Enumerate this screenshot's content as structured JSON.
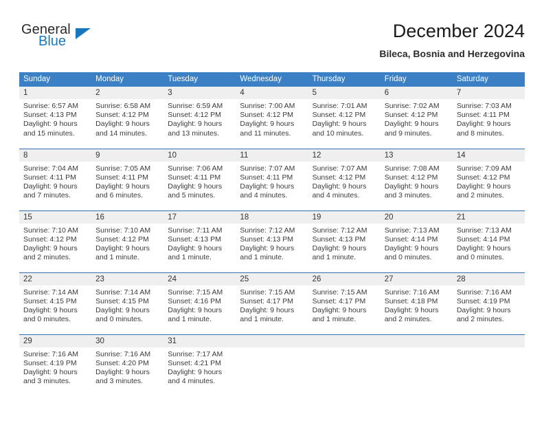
{
  "brand": {
    "word_one": "General",
    "word_two": "Blue",
    "triangle_icon": "triangle-right-icon",
    "accent_color": "#1878be"
  },
  "header": {
    "title": "December 2024",
    "subtitle": "Bileca, Bosnia and Herzegovina"
  },
  "theme": {
    "header_blue": "#3b80c4",
    "rule_blue": "#2f6fb0",
    "daynum_gray": "#efefef"
  },
  "weekday_headers": [
    "Sunday",
    "Monday",
    "Tuesday",
    "Wednesday",
    "Thursday",
    "Friday",
    "Saturday"
  ],
  "weeks": [
    [
      {
        "day": "1",
        "sunrise": "Sunrise: 6:57 AM",
        "sunset": "Sunset: 4:13 PM",
        "daylight_line1": "Daylight: 9 hours",
        "daylight_line2": "and 15 minutes."
      },
      {
        "day": "2",
        "sunrise": "Sunrise: 6:58 AM",
        "sunset": "Sunset: 4:12 PM",
        "daylight_line1": "Daylight: 9 hours",
        "daylight_line2": "and 14 minutes."
      },
      {
        "day": "3",
        "sunrise": "Sunrise: 6:59 AM",
        "sunset": "Sunset: 4:12 PM",
        "daylight_line1": "Daylight: 9 hours",
        "daylight_line2": "and 13 minutes."
      },
      {
        "day": "4",
        "sunrise": "Sunrise: 7:00 AM",
        "sunset": "Sunset: 4:12 PM",
        "daylight_line1": "Daylight: 9 hours",
        "daylight_line2": "and 11 minutes."
      },
      {
        "day": "5",
        "sunrise": "Sunrise: 7:01 AM",
        "sunset": "Sunset: 4:12 PM",
        "daylight_line1": "Daylight: 9 hours",
        "daylight_line2": "and 10 minutes."
      },
      {
        "day": "6",
        "sunrise": "Sunrise: 7:02 AM",
        "sunset": "Sunset: 4:12 PM",
        "daylight_line1": "Daylight: 9 hours",
        "daylight_line2": "and 9 minutes."
      },
      {
        "day": "7",
        "sunrise": "Sunrise: 7:03 AM",
        "sunset": "Sunset: 4:11 PM",
        "daylight_line1": "Daylight: 9 hours",
        "daylight_line2": "and 8 minutes."
      }
    ],
    [
      {
        "day": "8",
        "sunrise": "Sunrise: 7:04 AM",
        "sunset": "Sunset: 4:11 PM",
        "daylight_line1": "Daylight: 9 hours",
        "daylight_line2": "and 7 minutes."
      },
      {
        "day": "9",
        "sunrise": "Sunrise: 7:05 AM",
        "sunset": "Sunset: 4:11 PM",
        "daylight_line1": "Daylight: 9 hours",
        "daylight_line2": "and 6 minutes."
      },
      {
        "day": "10",
        "sunrise": "Sunrise: 7:06 AM",
        "sunset": "Sunset: 4:11 PM",
        "daylight_line1": "Daylight: 9 hours",
        "daylight_line2": "and 5 minutes."
      },
      {
        "day": "11",
        "sunrise": "Sunrise: 7:07 AM",
        "sunset": "Sunset: 4:11 PM",
        "daylight_line1": "Daylight: 9 hours",
        "daylight_line2": "and 4 minutes."
      },
      {
        "day": "12",
        "sunrise": "Sunrise: 7:07 AM",
        "sunset": "Sunset: 4:12 PM",
        "daylight_line1": "Daylight: 9 hours",
        "daylight_line2": "and 4 minutes."
      },
      {
        "day": "13",
        "sunrise": "Sunrise: 7:08 AM",
        "sunset": "Sunset: 4:12 PM",
        "daylight_line1": "Daylight: 9 hours",
        "daylight_line2": "and 3 minutes."
      },
      {
        "day": "14",
        "sunrise": "Sunrise: 7:09 AM",
        "sunset": "Sunset: 4:12 PM",
        "daylight_line1": "Daylight: 9 hours",
        "daylight_line2": "and 2 minutes."
      }
    ],
    [
      {
        "day": "15",
        "sunrise": "Sunrise: 7:10 AM",
        "sunset": "Sunset: 4:12 PM",
        "daylight_line1": "Daylight: 9 hours",
        "daylight_line2": "and 2 minutes."
      },
      {
        "day": "16",
        "sunrise": "Sunrise: 7:10 AM",
        "sunset": "Sunset: 4:12 PM",
        "daylight_line1": "Daylight: 9 hours",
        "daylight_line2": "and 1 minute."
      },
      {
        "day": "17",
        "sunrise": "Sunrise: 7:11 AM",
        "sunset": "Sunset: 4:13 PM",
        "daylight_line1": "Daylight: 9 hours",
        "daylight_line2": "and 1 minute."
      },
      {
        "day": "18",
        "sunrise": "Sunrise: 7:12 AM",
        "sunset": "Sunset: 4:13 PM",
        "daylight_line1": "Daylight: 9 hours",
        "daylight_line2": "and 1 minute."
      },
      {
        "day": "19",
        "sunrise": "Sunrise: 7:12 AM",
        "sunset": "Sunset: 4:13 PM",
        "daylight_line1": "Daylight: 9 hours",
        "daylight_line2": "and 1 minute."
      },
      {
        "day": "20",
        "sunrise": "Sunrise: 7:13 AM",
        "sunset": "Sunset: 4:14 PM",
        "daylight_line1": "Daylight: 9 hours",
        "daylight_line2": "and 0 minutes."
      },
      {
        "day": "21",
        "sunrise": "Sunrise: 7:13 AM",
        "sunset": "Sunset: 4:14 PM",
        "daylight_line1": "Daylight: 9 hours",
        "daylight_line2": "and 0 minutes."
      }
    ],
    [
      {
        "day": "22",
        "sunrise": "Sunrise: 7:14 AM",
        "sunset": "Sunset: 4:15 PM",
        "daylight_line1": "Daylight: 9 hours",
        "daylight_line2": "and 0 minutes."
      },
      {
        "day": "23",
        "sunrise": "Sunrise: 7:14 AM",
        "sunset": "Sunset: 4:15 PM",
        "daylight_line1": "Daylight: 9 hours",
        "daylight_line2": "and 0 minutes."
      },
      {
        "day": "24",
        "sunrise": "Sunrise: 7:15 AM",
        "sunset": "Sunset: 4:16 PM",
        "daylight_line1": "Daylight: 9 hours",
        "daylight_line2": "and 1 minute."
      },
      {
        "day": "25",
        "sunrise": "Sunrise: 7:15 AM",
        "sunset": "Sunset: 4:17 PM",
        "daylight_line1": "Daylight: 9 hours",
        "daylight_line2": "and 1 minute."
      },
      {
        "day": "26",
        "sunrise": "Sunrise: 7:15 AM",
        "sunset": "Sunset: 4:17 PM",
        "daylight_line1": "Daylight: 9 hours",
        "daylight_line2": "and 1 minute."
      },
      {
        "day": "27",
        "sunrise": "Sunrise: 7:16 AM",
        "sunset": "Sunset: 4:18 PM",
        "daylight_line1": "Daylight: 9 hours",
        "daylight_line2": "and 2 minutes."
      },
      {
        "day": "28",
        "sunrise": "Sunrise: 7:16 AM",
        "sunset": "Sunset: 4:19 PM",
        "daylight_line1": "Daylight: 9 hours",
        "daylight_line2": "and 2 minutes."
      }
    ],
    [
      {
        "day": "29",
        "sunrise": "Sunrise: 7:16 AM",
        "sunset": "Sunset: 4:19 PM",
        "daylight_line1": "Daylight: 9 hours",
        "daylight_line2": "and 3 minutes."
      },
      {
        "day": "30",
        "sunrise": "Sunrise: 7:16 AM",
        "sunset": "Sunset: 4:20 PM",
        "daylight_line1": "Daylight: 9 hours",
        "daylight_line2": "and 3 minutes."
      },
      {
        "day": "31",
        "sunrise": "Sunrise: 7:17 AM",
        "sunset": "Sunset: 4:21 PM",
        "daylight_line1": "Daylight: 9 hours",
        "daylight_line2": "and 4 minutes."
      },
      {
        "day": "",
        "sunrise": "",
        "sunset": "",
        "daylight_line1": "",
        "daylight_line2": ""
      },
      {
        "day": "",
        "sunrise": "",
        "sunset": "",
        "daylight_line1": "",
        "daylight_line2": ""
      },
      {
        "day": "",
        "sunrise": "",
        "sunset": "",
        "daylight_line1": "",
        "daylight_line2": ""
      },
      {
        "day": "",
        "sunrise": "",
        "sunset": "",
        "daylight_line1": "",
        "daylight_line2": ""
      }
    ]
  ]
}
